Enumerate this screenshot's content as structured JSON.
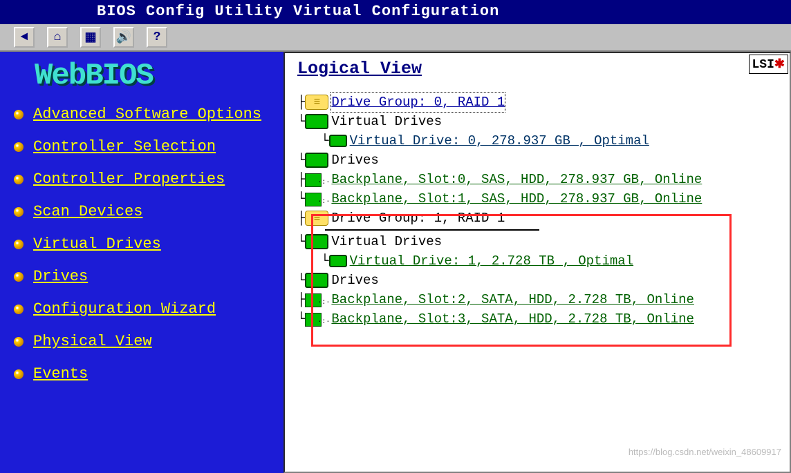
{
  "window": {
    "title": "BIOS Config Utility Virtual Configuration"
  },
  "logo": "WebBIOS",
  "sidebar": {
    "items": [
      "Advanced Software Options",
      "Controller Selection",
      "Controller Properties",
      "Scan Devices",
      "Virtual Drives",
      "Drives",
      "Configuration Wizard",
      "Physical View",
      "Events"
    ]
  },
  "panel": {
    "title": "Logical View",
    "lsi_label": "LSI"
  },
  "tree": {
    "dg0": {
      "label": "Drive Group: 0, RAID 1",
      "vd_header": "Virtual Drives",
      "vd0": "Virtual Drive: 0, 278.937 GB , Optimal",
      "drives_header": "Drives",
      "pd0": "Backplane, Slot:0, SAS, HDD, 278.937 GB, Online",
      "pd1": "Backplane, Slot:1, SAS, HDD, 278.937 GB, Online"
    },
    "dg1": {
      "label": "Drive Group: 1, RAID 1",
      "vd_header": "Virtual Drives",
      "vd1": "Virtual Drive: 1, 2.728 TB , Optimal",
      "drives_header": "Drives",
      "pd2": "Backplane, Slot:2, SATA, HDD, 2.728 TB, Online",
      "pd3": "Backplane, Slot:3, SATA, HDD, 2.728 TB, Online"
    }
  },
  "watermark": "https://blog.csdn.net/weixin_48609917"
}
